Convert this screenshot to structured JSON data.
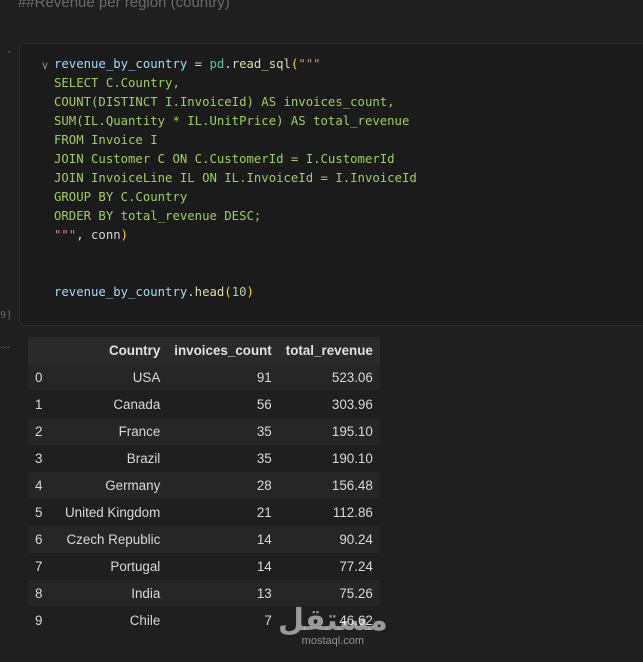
{
  "markdown_heading": "##Revenue per region (country)",
  "cell": {
    "exec_count": "9]",
    "code_lines": [
      [
        {
          "t": "revenue_by_country",
          "c": "v"
        },
        {
          "t": " = ",
          "c": "o"
        },
        {
          "t": "pd",
          "c": "m"
        },
        {
          "t": ".",
          "c": "o"
        },
        {
          "t": "read_sql",
          "c": "f"
        },
        {
          "t": "(",
          "c": "p"
        },
        {
          "t": "\"\"\"",
          "c": "s"
        }
      ],
      [
        {
          "t": "SELECT C.Country,",
          "c": "sql"
        }
      ],
      [
        {
          "t": "COUNT(DISTINCT I.InvoiceId) AS invoices_count,",
          "c": "sql"
        }
      ],
      [
        {
          "t": "SUM(IL.Quantity * IL.UnitPrice) AS total_revenue",
          "c": "sql"
        }
      ],
      [
        {
          "t": "FROM Invoice I",
          "c": "sql"
        }
      ],
      [
        {
          "t": "JOIN Customer C ON C.CustomerId = I.CustomerId",
          "c": "sql"
        }
      ],
      [
        {
          "t": "JOIN InvoiceLine IL ON IL.InvoiceId = I.InvoiceId",
          "c": "sql"
        }
      ],
      [
        {
          "t": "GROUP BY C.Country",
          "c": "sql"
        }
      ],
      [
        {
          "t": "ORDER BY total_revenue DESC;",
          "c": "sql"
        }
      ],
      [
        {
          "t": "\"\"\"",
          "c": "s"
        },
        {
          "t": ", conn",
          "c": "o"
        },
        {
          "t": ")",
          "c": "p"
        }
      ],
      [],
      [],
      [
        {
          "t": "revenue_by_country",
          "c": "v"
        },
        {
          "t": ".",
          "c": "o"
        },
        {
          "t": "head",
          "c": "f"
        },
        {
          "t": "(",
          "c": "p"
        },
        {
          "t": "10",
          "c": "n"
        },
        {
          "t": ")",
          "c": "p"
        }
      ]
    ]
  },
  "output": {
    "columns": [
      "",
      "Country",
      "invoices_count",
      "total_revenue"
    ],
    "rows": [
      [
        "0",
        "USA",
        "91",
        "523.06"
      ],
      [
        "1",
        "Canada",
        "56",
        "303.96"
      ],
      [
        "2",
        "France",
        "35",
        "195.10"
      ],
      [
        "3",
        "Brazil",
        "35",
        "190.10"
      ],
      [
        "4",
        "Germany",
        "28",
        "156.48"
      ],
      [
        "5",
        "United Kingdom",
        "21",
        "112.86"
      ],
      [
        "6",
        "Czech Republic",
        "14",
        "90.24"
      ],
      [
        "7",
        "Portugal",
        "14",
        "77.24"
      ],
      [
        "8",
        "India",
        "13",
        "75.26"
      ],
      [
        "9",
        "Chile",
        "7",
        "46.62"
      ]
    ]
  },
  "watermark": {
    "logo": "مستقل",
    "sub": "mostaql.com"
  }
}
